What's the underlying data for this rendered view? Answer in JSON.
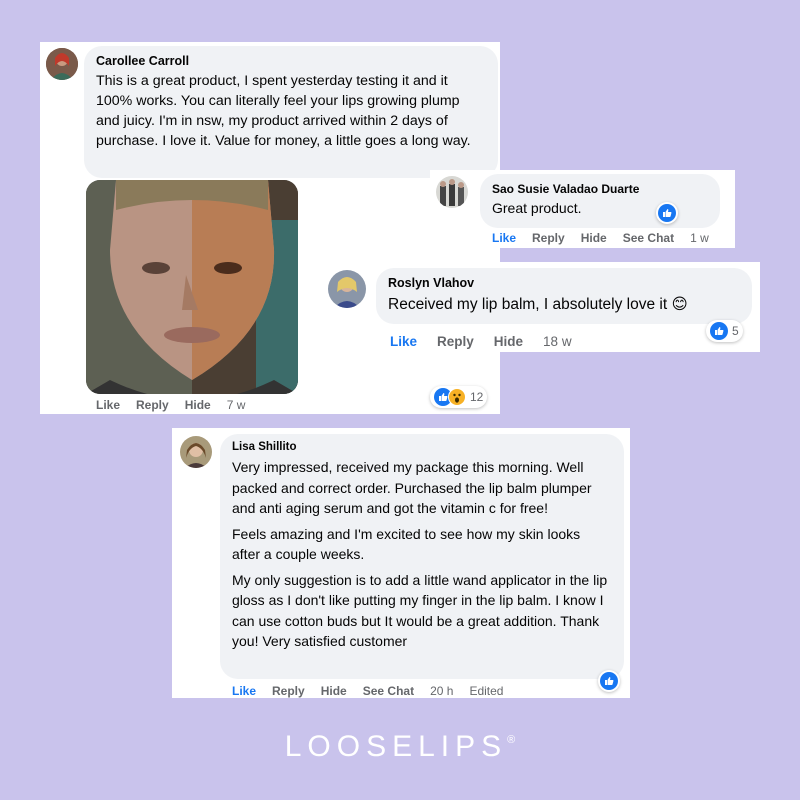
{
  "comments": [
    {
      "author": "Carollee Carroll",
      "text": "This is a great product, I spent yesterday testing it and it 100% works. You can literally feel your lips growing plump and juicy. I'm in nsw, my product arrived within 2 days of purchase. I love it. Value for money, a little goes a long way.",
      "actions": [
        "Like",
        "Reply",
        "Hide"
      ],
      "time": "7 w",
      "reaction_count": "12",
      "reactions": [
        "like-icon",
        "wow-icon"
      ]
    },
    {
      "author": "Sao Susie Valadao Duarte",
      "text": "Great product.",
      "actions": [
        "Like",
        "Reply",
        "Hide",
        "See Chat"
      ],
      "time": "1 w",
      "reactions": [
        "like-icon"
      ]
    },
    {
      "author": "Roslyn Vlahov",
      "text": "Received my lip balm, I absolutely love it",
      "emoji": "😊",
      "actions": [
        "Like",
        "Reply",
        "Hide"
      ],
      "time": "18 w",
      "reaction_count": "5",
      "reactions": [
        "like-icon"
      ]
    },
    {
      "author": "Lisa Shillito",
      "paragraphs": [
        "Very impressed, received my package this morning. Well packed and correct order. Purchased the lip balm plumper and anti aging serum and got the vitamin c for free!",
        "Feels amazing and I'm excited to see how my skin looks after a couple weeks.",
        "My only suggestion is to add a little wand applicator in the lip gloss as I don't like putting my finger in the lip balm. I know I can use cotton buds but It would be a great addition. Thank you! Very satisfied customer"
      ],
      "actions": [
        "Like",
        "Reply",
        "Hide",
        "See Chat"
      ],
      "time": "20 h",
      "edited": "Edited",
      "reactions": [
        "like-icon"
      ]
    }
  ],
  "brand": {
    "name": "LOOSELIPS",
    "mark": "®"
  },
  "colors": {
    "background": "#c9c3ec",
    "bubble": "#f0f2f5",
    "like_blue": "#1877f2",
    "muted": "#65676b"
  }
}
